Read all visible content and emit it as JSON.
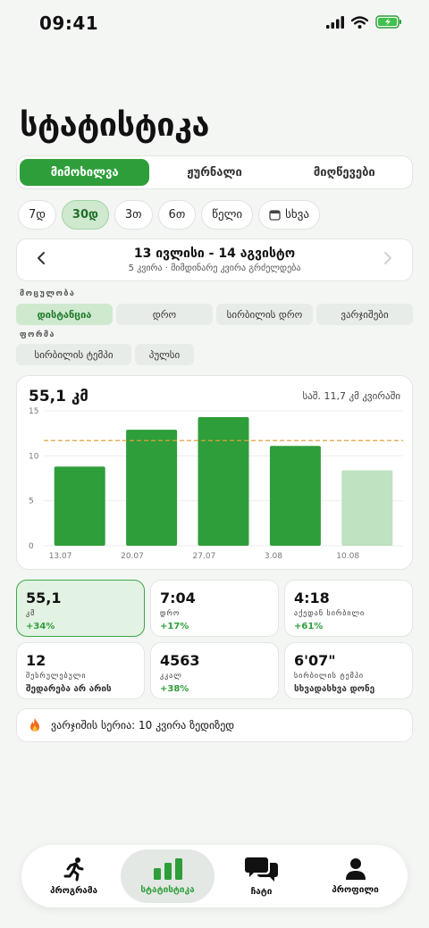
{
  "status": {
    "time": "09:41"
  },
  "page_title": "სტატისტიკა",
  "segments": [
    {
      "label": "მიმოხილვა",
      "active": true
    },
    {
      "label": "ჟურნალი",
      "active": false
    },
    {
      "label": "მიღწევები",
      "active": false
    }
  ],
  "periods": [
    {
      "label": "7დ",
      "active": false
    },
    {
      "label": "30დ",
      "active": true
    },
    {
      "label": "3თ",
      "active": false
    },
    {
      "label": "6თ",
      "active": false
    },
    {
      "label": "წელი",
      "active": false
    },
    {
      "label": "სხვა",
      "active": false,
      "icon": "calendar-icon"
    }
  ],
  "range": {
    "title": "13 ივლისი - 14 აგვისტო",
    "subtitle": "5 კვირა · მიმდინარე კვირა გრძელდება"
  },
  "metric_section": {
    "label": "მოცულობა",
    "items": [
      {
        "label": "დისტანცია",
        "active": true
      },
      {
        "label": "დრო",
        "active": false
      },
      {
        "label": "სირბილის დრო",
        "active": false
      },
      {
        "label": "ვარჯიშები",
        "active": false
      }
    ]
  },
  "form_section": {
    "label": "ფორმა",
    "items": [
      {
        "label": "სირბილის ტემპი",
        "active": false
      },
      {
        "label": "პულსი",
        "active": false
      }
    ]
  },
  "chart": {
    "total": "55,1 კმ",
    "average": "საშ. 11,7 კმ კვირაში"
  },
  "chart_data": {
    "type": "bar",
    "categories": [
      "13.07",
      "20.07",
      "27.07",
      "3.08",
      "10.08"
    ],
    "values": [
      8.8,
      12.9,
      14.3,
      11.1,
      8.4
    ],
    "ylim": [
      0,
      15
    ],
    "yticks": [
      0,
      5,
      10,
      15
    ],
    "average_line": 11.7,
    "grid": true,
    "colors": {
      "bar": "#2e9e3a",
      "bar_current": "#bfe2c0",
      "avg_line": "#e0a23a"
    }
  },
  "stats": [
    {
      "value": "55,1",
      "label": "კმ",
      "delta": "+34%",
      "active": true,
      "neutral": false
    },
    {
      "value": "7:04",
      "label": "დრო",
      "delta": "+17%",
      "active": false,
      "neutral": false
    },
    {
      "value": "4:18",
      "label": "აქედან სირბილი",
      "delta": "+61%",
      "active": false,
      "neutral": false
    },
    {
      "value": "12",
      "label": "შესრულებული",
      "delta": "შედარება არ არის",
      "active": false,
      "neutral": true
    },
    {
      "value": "4563",
      "label": "კკალ",
      "delta": "+38%",
      "active": false,
      "neutral": false
    },
    {
      "value": "6'07\"",
      "label": "სირბილის ტემპი",
      "delta": "სხვადასხვა დონე",
      "active": false,
      "neutral": true
    }
  ],
  "streak": {
    "icon": "fire-icon",
    "text": "ვარჯიშის სერია: 10 კვირა ზედიზედ"
  },
  "tabs": [
    {
      "label": "პროგრამა",
      "icon": "runner-icon",
      "active": false
    },
    {
      "label": "სტატისტიკა",
      "icon": "bar-chart-icon",
      "active": true
    },
    {
      "label": "ჩატი",
      "icon": "chat-icon",
      "active": false
    },
    {
      "label": "პროფილი",
      "icon": "person-icon",
      "active": false
    }
  ],
  "colors": {
    "accent": "#2e9e3a",
    "accent_light": "#cfe9cf",
    "background": "#f4f6f4"
  }
}
